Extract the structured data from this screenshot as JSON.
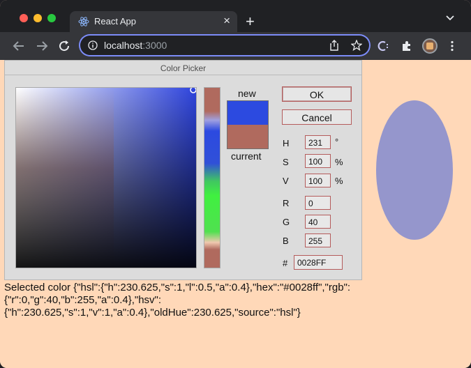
{
  "browser": {
    "tab_title": "React App",
    "tab_close": "×",
    "new_tab": "+",
    "url_host": "localhost",
    "url_port": ":3000"
  },
  "picker": {
    "header": "Color Picker",
    "new_label": "new",
    "current_label": "current",
    "ok_label": "OK",
    "cancel_label": "Cancel",
    "new_color": "#2c4ae0",
    "current_color": "#b06a5e",
    "fields": {
      "h": {
        "label": "H",
        "value": "231",
        "unit": "°"
      },
      "s": {
        "label": "S",
        "value": "100",
        "unit": "%"
      },
      "v": {
        "label": "V",
        "value": "100",
        "unit": "%"
      },
      "r": {
        "label": "R",
        "value": "0"
      },
      "g": {
        "label": "G",
        "value": "40"
      },
      "b": {
        "label": "B",
        "value": "255"
      },
      "hex": {
        "label": "#",
        "value": "0028FF"
      }
    }
  },
  "selected_text": "Selected color {\"hsl\":{\"h\":230.625,\"s\":1,\"l\":0.5,\"a\":0.4},\"hex\":\"#0028ff\",\"rgb\":{\"r\":0,\"g\":40,\"b\":255,\"a\":0.4},\"hsv\":{\"h\":230.625,\"s\":1,\"v\":1,\"a\":0.4},\"oldHue\":230.625,\"source\":\"hsl\"}",
  "colors": {
    "page_background": "#ffd8b8",
    "preview_fill": "#9596cc",
    "accent_border": "#b45b5b"
  }
}
